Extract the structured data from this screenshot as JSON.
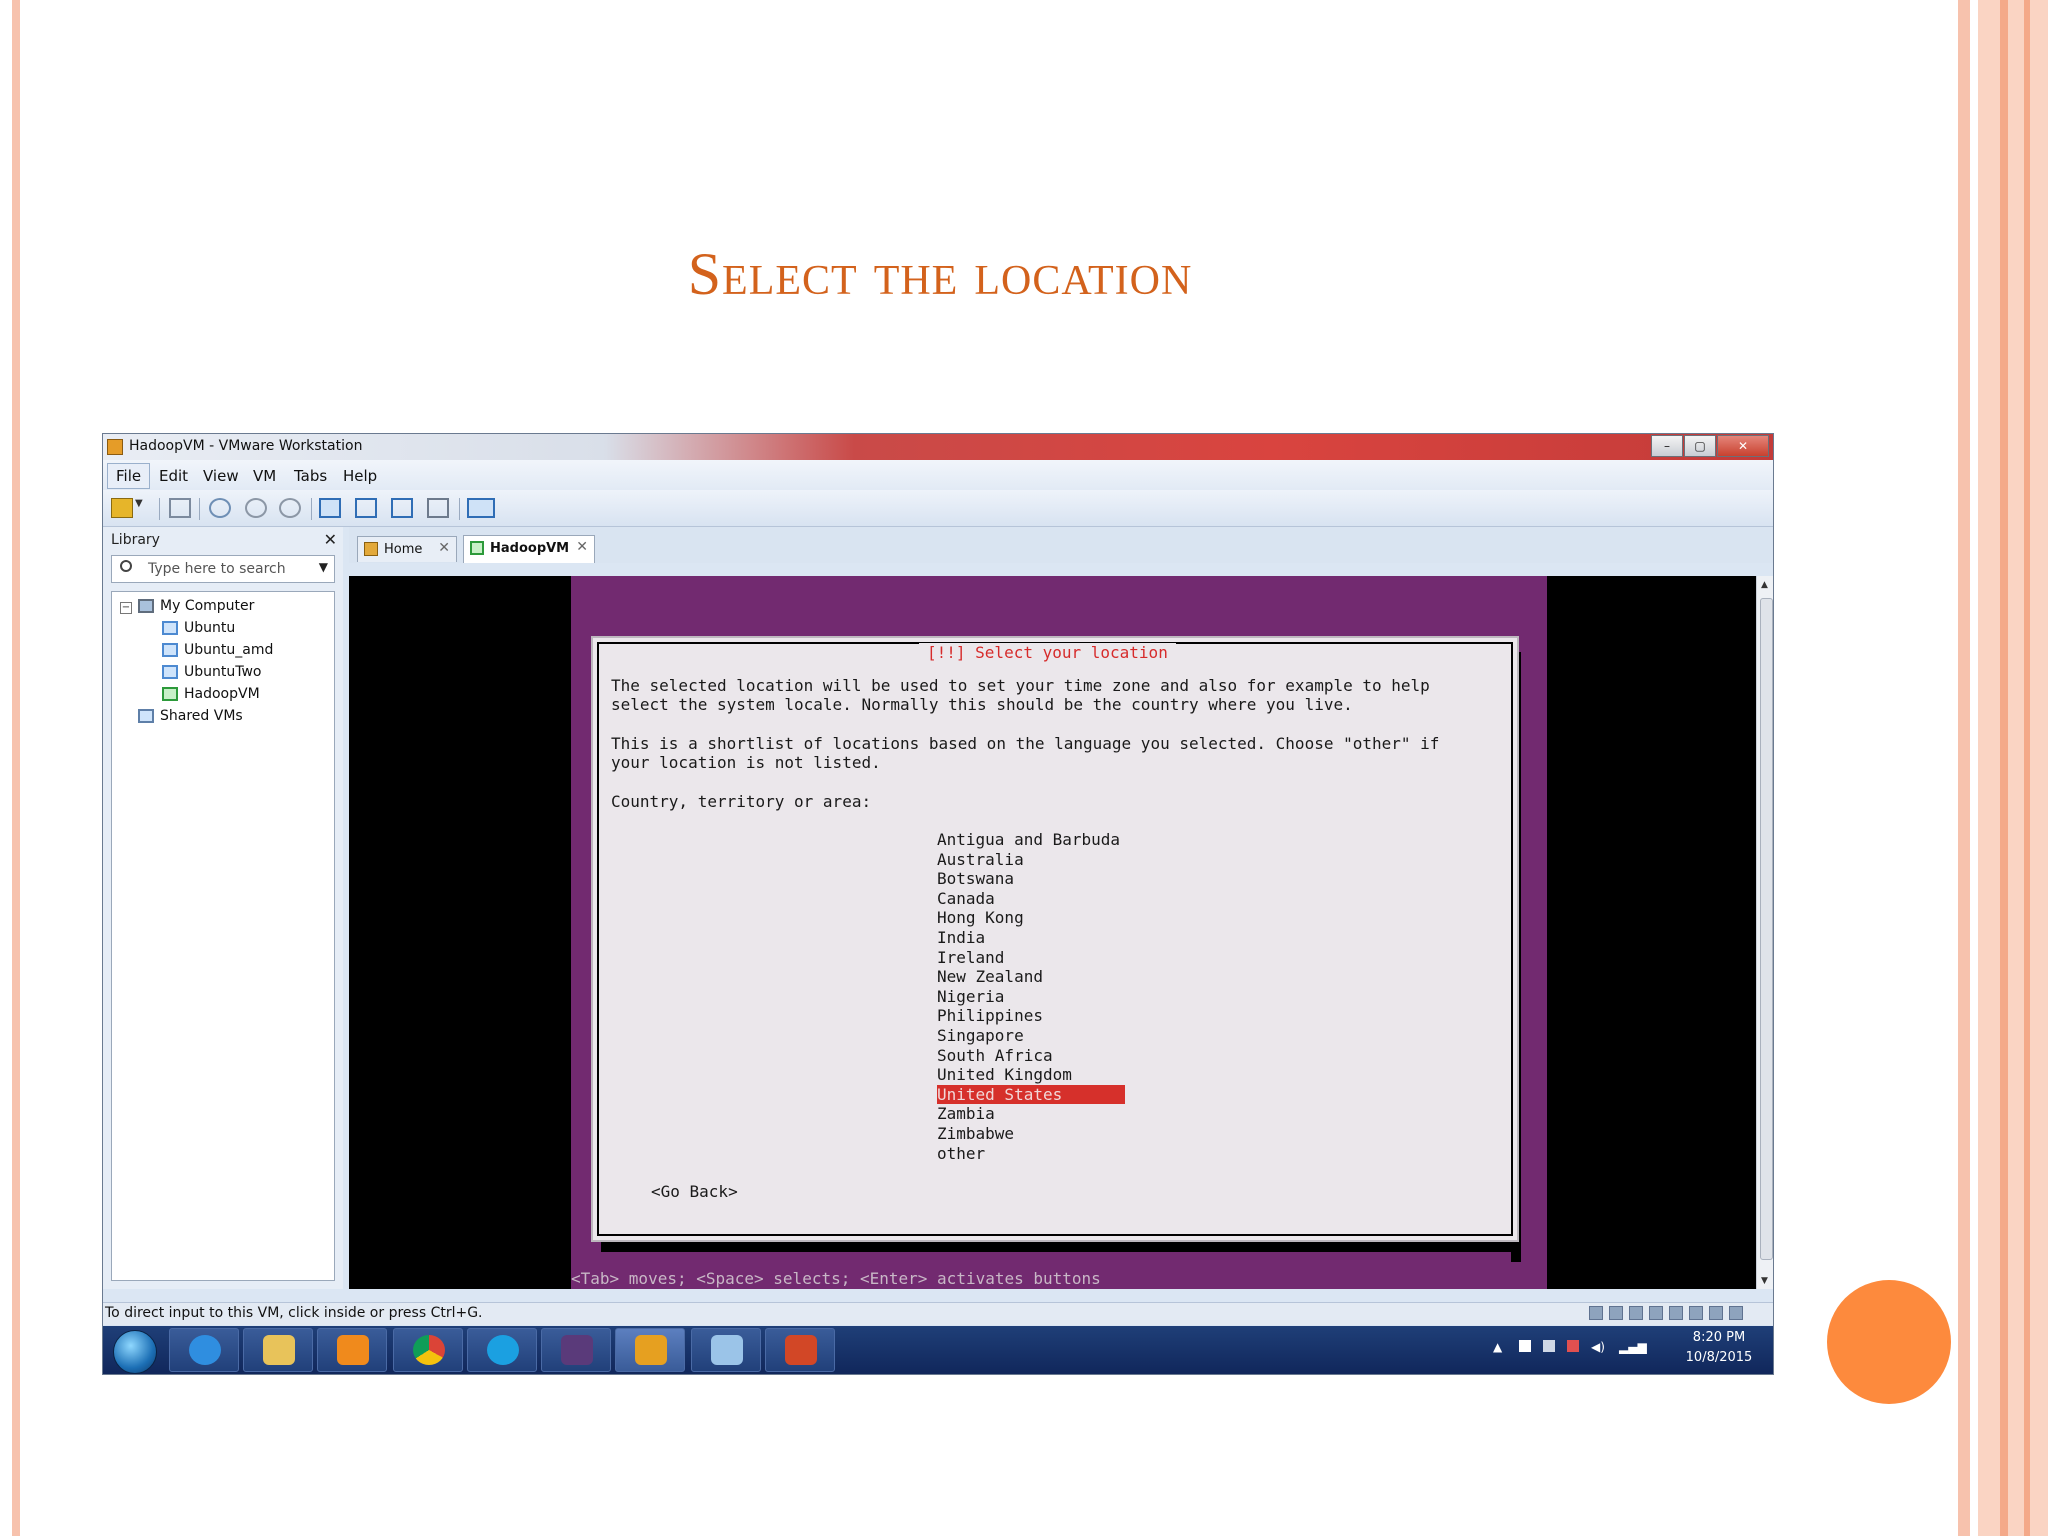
{
  "slide": {
    "title": "Select the location"
  },
  "window": {
    "title": "HadoopVM - VMware Workstation",
    "buttons": {
      "minimize": "–",
      "maximize": "▢",
      "close": "✕"
    }
  },
  "menu": {
    "items": [
      "File",
      "Edit",
      "View",
      "VM",
      "Tabs",
      "Help"
    ]
  },
  "library": {
    "header": "Library",
    "close": "✕",
    "search_placeholder": "Type here to search",
    "tree": {
      "root": "My Computer",
      "vms": [
        "Ubuntu",
        "Ubuntu_amd",
        "UbuntuTwo",
        "HadoopVM"
      ],
      "shared": "Shared VMs"
    }
  },
  "tabs": [
    {
      "label": "Home",
      "close": "✕"
    },
    {
      "label": "HadoopVM",
      "close": "✕"
    }
  ],
  "installer": {
    "dialog_title": "[!!] Select your location",
    "paragraph1_line1": "The selected location will be used to set your time zone and also for example to help",
    "paragraph1_line2": "select the system locale. Normally this should be the country where you live.",
    "paragraph2_line1": "This is a shortlist of locations based on the language you selected. Choose \"other\" if",
    "paragraph2_line2": "your location is not listed.",
    "prompt": "Country, territory or area:",
    "locations": [
      "Antigua and Barbuda",
      "Australia",
      "Botswana",
      "Canada",
      "Hong Kong",
      "India",
      "Ireland",
      "New Zealand",
      "Nigeria",
      "Philippines",
      "Singapore",
      "South Africa",
      "United Kingdom",
      "United States",
      "Zambia",
      "Zimbabwe",
      "other"
    ],
    "selected": "United States",
    "go_back": "<Go Back>",
    "hint": "<Tab> moves; <Space> selects; <Enter> activates buttons"
  },
  "statusbar": {
    "text": "To direct input to this VM, click inside or press Ctrl+G."
  },
  "taskbar": {
    "time": "8:20 PM",
    "date": "10/8/2015"
  },
  "colors": {
    "title_orange": "#d3621c",
    "installer_purple": "#722a70",
    "selection_red": "#d6302b",
    "circle_orange": "#fd8a3d"
  }
}
